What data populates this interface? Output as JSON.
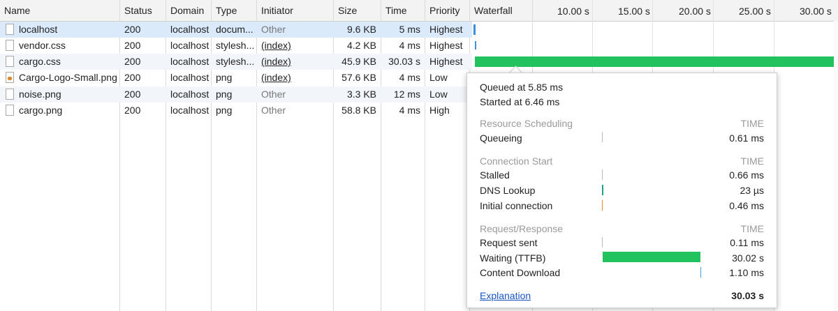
{
  "columns": {
    "name": "Name",
    "status": "Status",
    "domain": "Domain",
    "type": "Type",
    "initiator": "Initiator",
    "size": "Size",
    "time": "Time",
    "priority": "Priority",
    "waterfall": "Waterfall"
  },
  "waterfall_ticks": [
    "10.00 s",
    "15.00 s",
    "20.00 s",
    "25.00 s",
    "30.00 s"
  ],
  "requests": [
    {
      "name": "localhost",
      "status": "200",
      "domain": "localhost",
      "type": "docum...",
      "initiator": "Other",
      "initiator_link": false,
      "size": "9.6 KB",
      "time": "5 ms",
      "priority": "Highest",
      "icon": "document-icon",
      "selected": true
    },
    {
      "name": "vendor.css",
      "status": "200",
      "domain": "localhost",
      "type": "stylesh...",
      "initiator": "(index)",
      "initiator_link": true,
      "size": "4.2 KB",
      "time": "4 ms",
      "priority": "Highest",
      "icon": "document-icon",
      "selected": false
    },
    {
      "name": "cargo.css",
      "status": "200",
      "domain": "localhost",
      "type": "stylesh...",
      "initiator": "(index)",
      "initiator_link": true,
      "size": "45.9 KB",
      "time": "30.03 s",
      "priority": "Highest",
      "icon": "document-icon",
      "selected": false
    },
    {
      "name": "Cargo-Logo-Small.png",
      "status": "200",
      "domain": "localhost",
      "type": "png",
      "initiator": "(index)",
      "initiator_link": true,
      "size": "57.6 KB",
      "time": "4 ms",
      "priority": "Low",
      "icon": "image-file-icon",
      "selected": false
    },
    {
      "name": "noise.png",
      "status": "200",
      "domain": "localhost",
      "type": "png",
      "initiator": "Other",
      "initiator_link": false,
      "size": "3.3 KB",
      "time": "12 ms",
      "priority": "Low",
      "icon": "document-icon",
      "selected": false
    },
    {
      "name": "cargo.png",
      "status": "200",
      "domain": "localhost",
      "type": "png",
      "initiator": "Other",
      "initiator_link": false,
      "size": "58.8 KB",
      "time": "4 ms",
      "priority": "High",
      "icon": "document-icon",
      "selected": false
    }
  ],
  "timing_popup": {
    "queued_at": "Queued at 5.85 ms",
    "started_at": "Started at 6.46 ms",
    "time_header": "TIME",
    "sections": [
      {
        "title": "Resource Scheduling",
        "rows": [
          {
            "label": "Queueing",
            "value": "0.61 ms",
            "color": "#bbbbbb"
          }
        ]
      },
      {
        "title": "Connection Start",
        "rows": [
          {
            "label": "Stalled",
            "value": "0.66 ms",
            "color": "#bbbbbb"
          },
          {
            "label": "DNS Lookup",
            "value": "23 µs",
            "color": "#1aa385"
          },
          {
            "label": "Initial connection",
            "value": "0.46 ms",
            "color": "#f08a24"
          }
        ]
      },
      {
        "title": "Request/Response",
        "rows": [
          {
            "label": "Request sent",
            "value": "0.11 ms",
            "color": "#bbbbbb"
          },
          {
            "label": "Waiting (TTFB)",
            "value": "30.02 s",
            "color": "#22c35e"
          },
          {
            "label": "Content Download",
            "value": "1.10 ms",
            "color": "#3ea0e8"
          }
        ]
      }
    ],
    "explanation": "Explanation",
    "total": "30.03 s"
  },
  "colors": {
    "selected_row": "#dbeafb",
    "striped_row": "#f2f5fa",
    "ttfb_green": "#22c35e",
    "waterfall_blue": "#3b8fe0"
  }
}
